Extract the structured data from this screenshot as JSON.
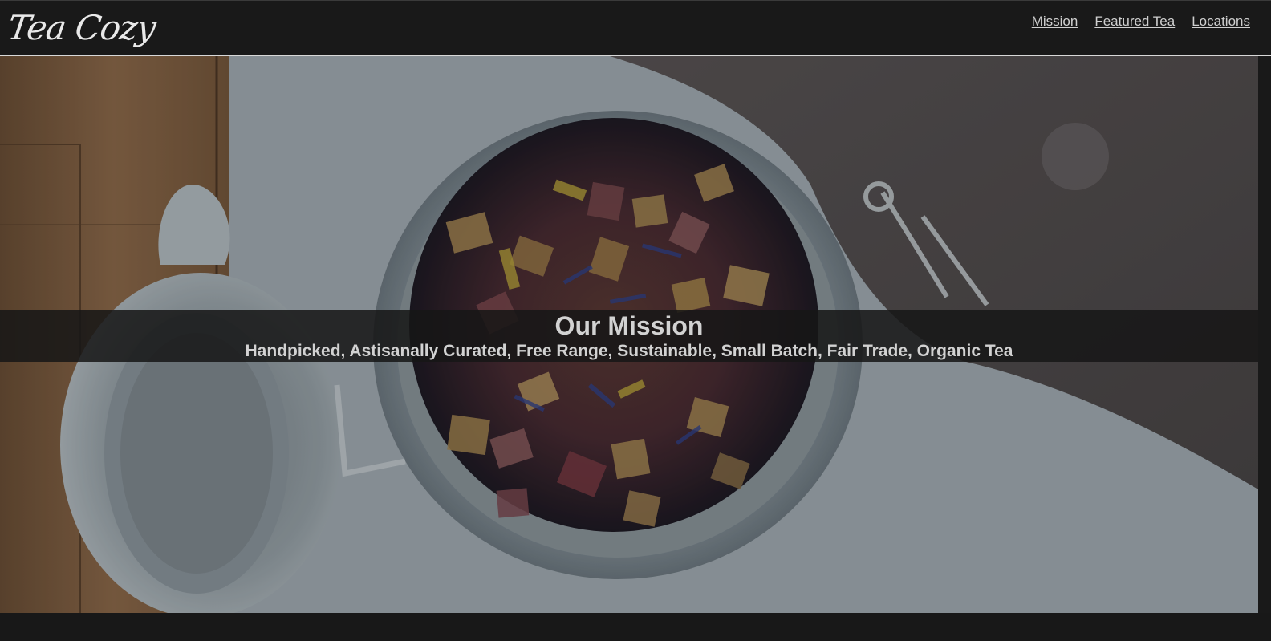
{
  "header": {
    "logo_text": "Tea Cozy",
    "nav": [
      {
        "label": "Mission"
      },
      {
        "label": "Featured Tea"
      },
      {
        "label": "Locations"
      }
    ]
  },
  "hero": {
    "title": "Our Mission",
    "subtitle": "Handpicked, Astisanally Curated, Free Range, Sustainable, Small Batch, Fair Trade, Organic Tea",
    "image_description_icon": "tea-jar-photo"
  },
  "colors": {
    "header_bg": "#191919",
    "text_light": "#d2d2d2",
    "band_bg": "#161616"
  }
}
